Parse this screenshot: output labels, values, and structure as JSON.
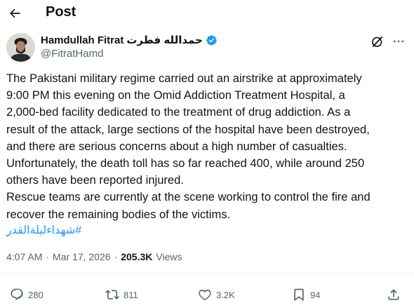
{
  "header": {
    "title": "Post",
    "back_icon": "arrow-left-icon"
  },
  "author": {
    "name": "Hamdullah Fitrat",
    "name_native": "حمدالله فطرت",
    "handle": "@FitratHamd",
    "verified_color": "#1d9bf0"
  },
  "post": {
    "text": "The Pakistani military regime carried out an airstrike at approximately\n9:00 PM this evening on the Omid Addiction Treatment Hospital, a\n2,000-bed facility dedicated to the treatment of drug addiction. As a\nresult of the attack, large sections of the hospital have been destroyed,\nand there are serious concerns about a high number of casualties.\nUnfortunately, the death toll has so far reached 400, while around 250\nothers have been reported injured.\nRescue teams are currently at the scene working to control the fire and\nrecover the remaining bodies of the victims.",
    "hashtag": "#شهداءليلةالقدر",
    "time": "4:07 AM",
    "date": "Mar 17, 2026",
    "sep": "·",
    "views_count": "205.3K",
    "views_label": "Views"
  },
  "actions": {
    "replies": "280",
    "reposts": "811",
    "likes": "3.2K",
    "bookmarks": "94"
  },
  "colors": {
    "text": "#0f1419",
    "muted": "#536471",
    "link": "#1d9bf0"
  }
}
